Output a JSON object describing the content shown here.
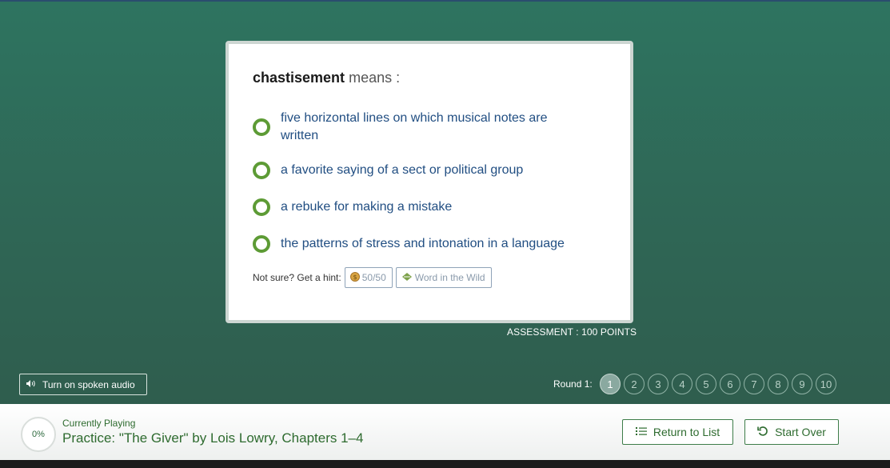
{
  "question": {
    "word": "chastisement",
    "prompt": "means :"
  },
  "choices": [
    {
      "label": "five horizontal lines on which musical notes are written"
    },
    {
      "label": "a favorite saying of a sect or political group"
    },
    {
      "label": "a rebuke for making a mistake"
    },
    {
      "label": "the patterns of stress and intonation in a language"
    }
  ],
  "hints": {
    "prompt": "Not sure? Get a hint:",
    "fifty_label": "50/50",
    "fifty_icon": "coin-icon",
    "wild_label": "Word in the Wild",
    "wild_icon": "leaf-icon"
  },
  "assessment": "ASSESSMENT : 100 POINTS",
  "audio": {
    "label": "Turn on spoken audio",
    "icon": "speaker-icon"
  },
  "rounds": {
    "label": "Round 1:",
    "items": [
      "1",
      "2",
      "3",
      "4",
      "5",
      "6",
      "7",
      "8",
      "9",
      "10"
    ],
    "active": 1
  },
  "footer": {
    "progress": "0%",
    "currently_playing": "Currently Playing",
    "title": "Practice: \"The Giver\" by Lois Lowry, Chapters 1–4",
    "return_label": "Return to List",
    "return_icon": "list-icon",
    "start_over_label": "Start Over",
    "start_over_icon": "restart-icon"
  },
  "colors": {
    "background": "#2f6756",
    "radio": "#5d9b35",
    "choice_text": "#214e82",
    "brand_green": "#2e6b2f"
  }
}
